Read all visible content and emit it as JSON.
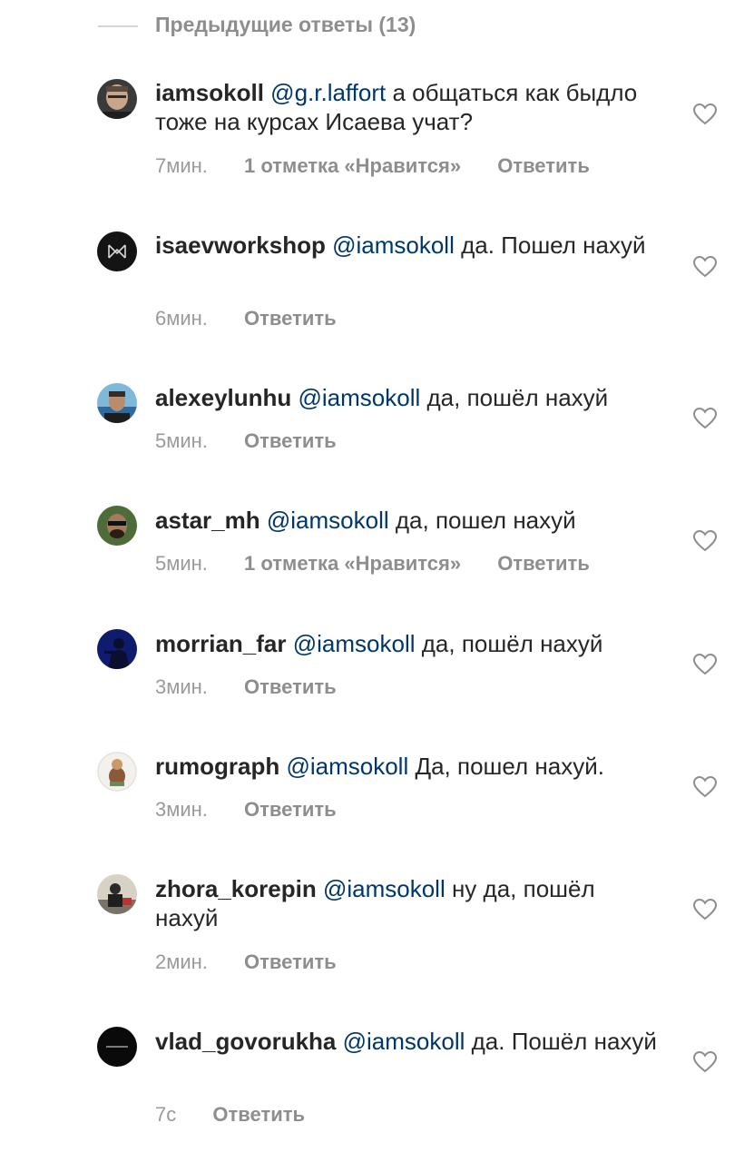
{
  "previous_replies_label": "Предыдущие ответы (13)",
  "reply_label": "Ответить",
  "comments": [
    {
      "username": "iamsokoll",
      "mention": "@g.r.laffort",
      "text": "а общаться как быдло тоже на курсах Исаева учат?",
      "time": "7мин.",
      "likes": "1 отметка «Нравится»"
    },
    {
      "username": "isaevworkshop",
      "mention": "@iamsokoll",
      "text": "да. Пошел нахуй",
      "time": "6мин.",
      "likes": ""
    },
    {
      "username": "alexeylunhu",
      "mention": "@iamsokoll",
      "text": "да, пошёл нахуй",
      "time": "5мин.",
      "likes": ""
    },
    {
      "username": "astar_mh",
      "mention": "@iamsokoll",
      "text": "да, пошел нахуй",
      "time": "5мин.",
      "likes": "1 отметка «Нравится»"
    },
    {
      "username": "morrian_far",
      "mention": "@iamsokoll",
      "text": "да, пошёл нахуй",
      "time": "3мин.",
      "likes": ""
    },
    {
      "username": "rumograph",
      "mention": "@iamsokoll",
      "text": "Да, пошел нахуй.",
      "time": "3мин.",
      "likes": ""
    },
    {
      "username": "zhora_korepin",
      "mention": "@iamsokoll",
      "text": "ну да, пошёл нахуй",
      "time": "2мин.",
      "likes": ""
    },
    {
      "username": "vlad_govorukha",
      "mention": "@iamsokoll",
      "text": "да. Пошёл нахуй",
      "time": "7с",
      "likes": ""
    }
  ],
  "colors": {
    "text": "#262626",
    "mention": "#00376b",
    "secondary": "#8e8e8e"
  }
}
